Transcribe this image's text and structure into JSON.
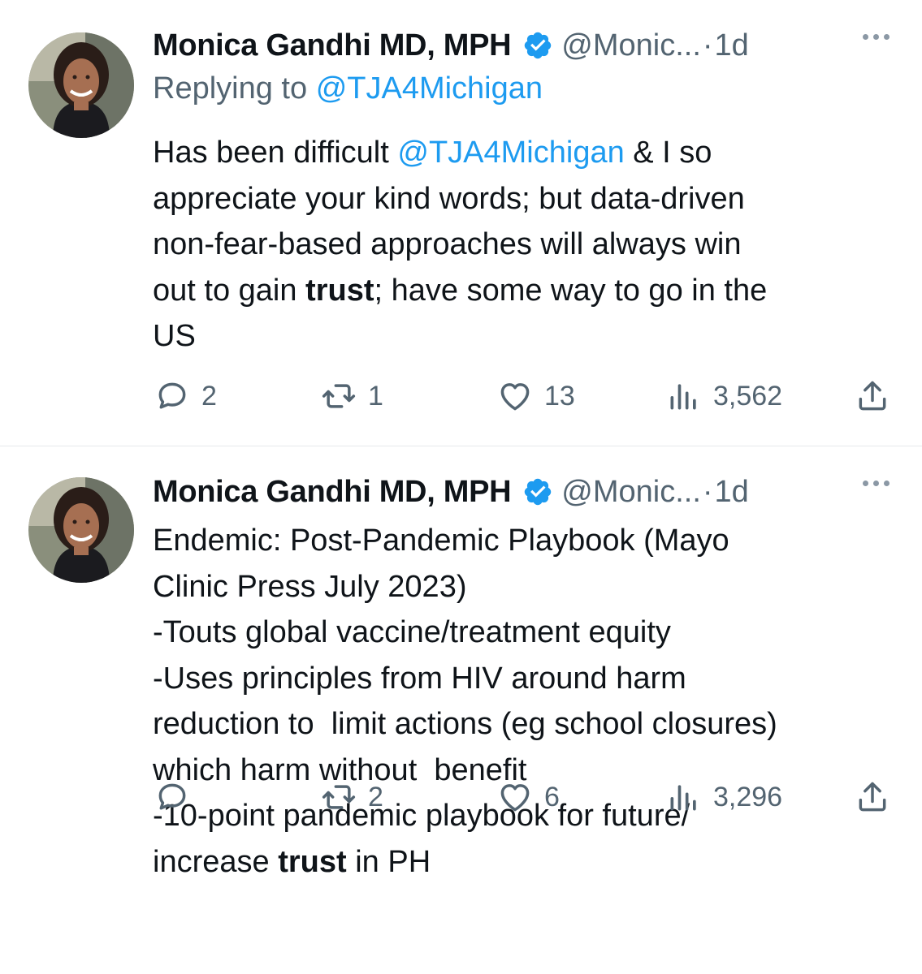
{
  "tweets": [
    {
      "author_name": "Monica Gandhi MD, MPH",
      "handle": "@Monic...",
      "separator": "·",
      "time": "1d",
      "reply_prefix": "Replying to",
      "reply_handle": "@TJA4Michigan",
      "body": {
        "t1": "Has been difficult ",
        "mention": "@TJA4Michigan",
        "t2": " & I so\nappreciate your kind words; but data-driven\nnon-fear-based approaches will always win\nout to gain ",
        "bold": "trust",
        "t3": "; have some way to go in the\nUS"
      },
      "stats": {
        "replies": "2",
        "retweets": "1",
        "likes": "13",
        "views": "3,562"
      }
    },
    {
      "author_name": "Monica Gandhi MD, MPH",
      "handle": "@Monic...",
      "separator": "·",
      "time": "1d",
      "body": {
        "t1": "Endemic: Post-Pandemic Playbook (Mayo\nClinic Press July 2023)\n-Touts global vaccine/treatment equity\n-Uses principles from HIV around harm\nreduction to  limit actions (eg school closures)\nwhich harm without  benefit\n-10-point pandemic playbook for future/\nincrease ",
        "bold": "trust",
        "t2": " in PH"
      },
      "stats": {
        "replies": "",
        "retweets": "2",
        "likes": "6",
        "views": "3,296"
      }
    }
  ],
  "icons": {
    "verified": "verified-badge-icon",
    "more": "more-options-icon",
    "reply": "reply-icon",
    "retweet": "retweet-icon",
    "like": "heart-icon",
    "views": "views-icon",
    "share": "share-icon"
  },
  "colors": {
    "text": "#0f1419",
    "muted": "#536471",
    "link": "#1d9bf0",
    "verified": "#1d9bf0",
    "divider": "#e6e9ec"
  }
}
